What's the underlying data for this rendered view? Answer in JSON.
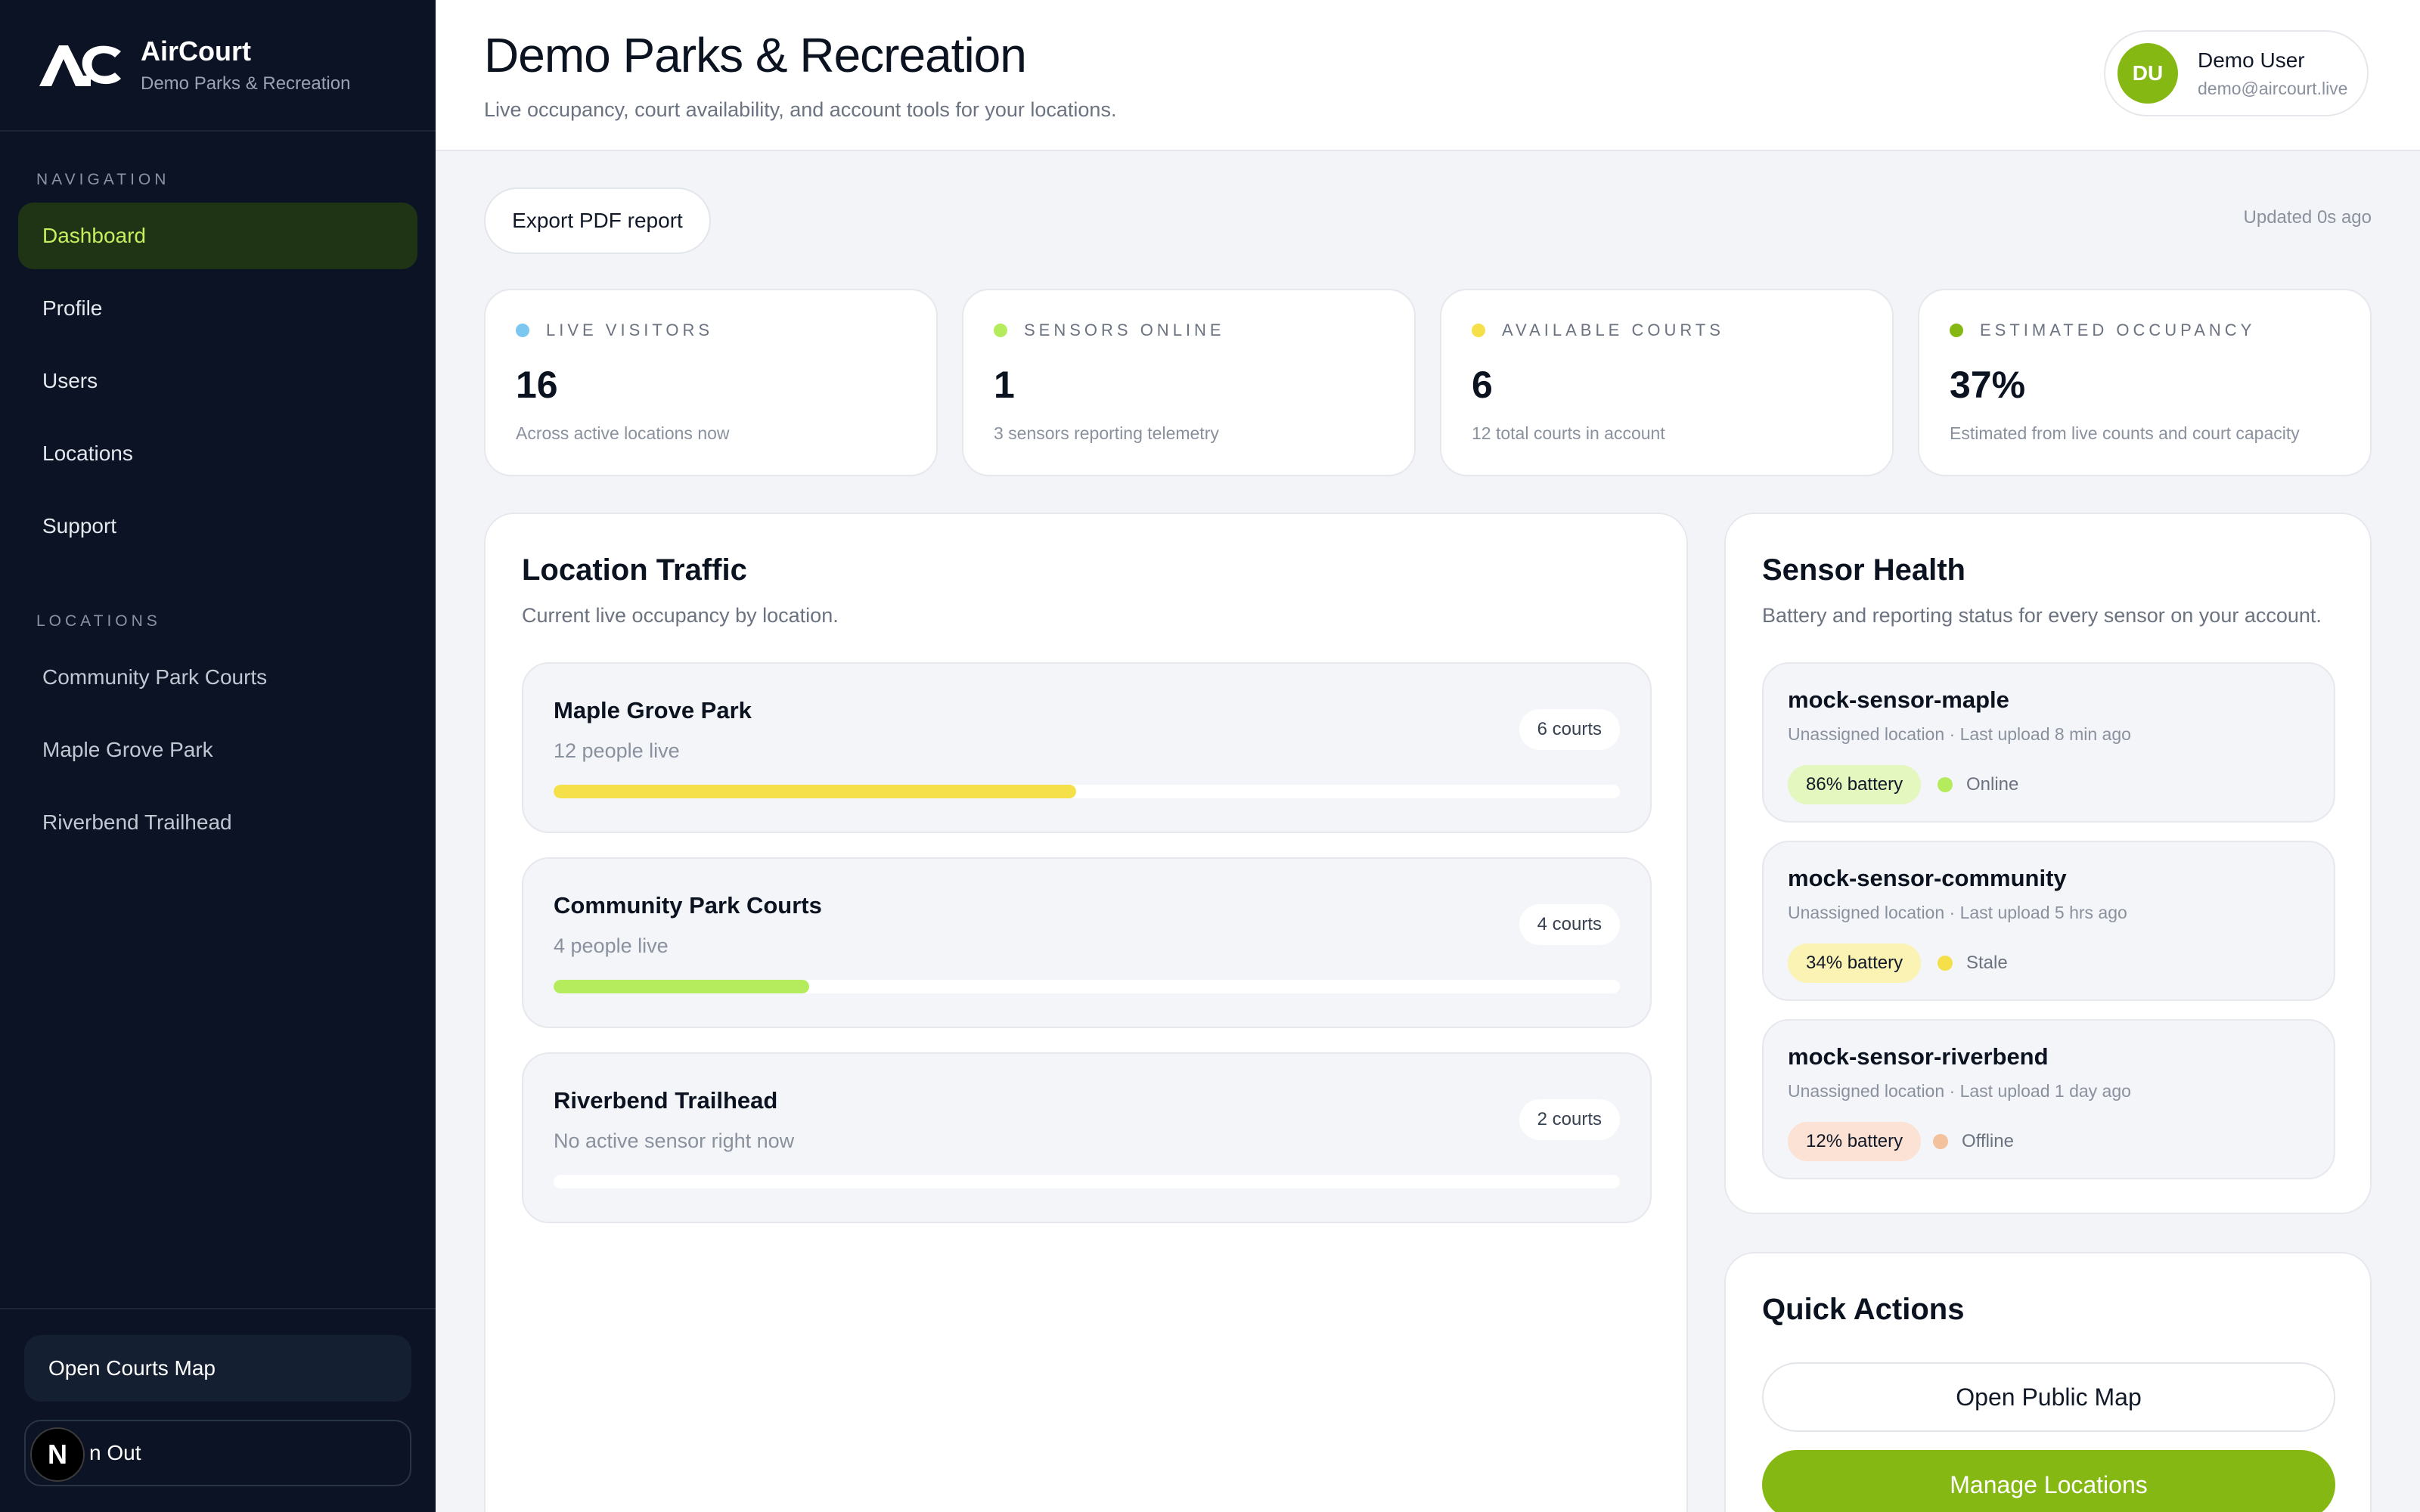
{
  "brand": {
    "name": "AirCourt",
    "subtitle": "Demo Parks & Recreation"
  },
  "sidebar": {
    "nav_heading": "NAVIGATION",
    "nav_items": [
      {
        "label": "Dashboard",
        "active": true
      },
      {
        "label": "Profile"
      },
      {
        "label": "Users"
      },
      {
        "label": "Locations"
      },
      {
        "label": "Support"
      }
    ],
    "locations_heading": "LOCATIONS",
    "locations": [
      {
        "label": "Community Park Courts"
      },
      {
        "label": "Maple Grove Park"
      },
      {
        "label": "Riverbend Trailhead"
      }
    ],
    "open_map_label": "Open Courts Map",
    "sign_out_label": "n Out",
    "overlay_badge": "N"
  },
  "header": {
    "title": "Demo Parks & Recreation",
    "subtitle": "Live occupancy, court availability, and account tools for your locations.",
    "user": {
      "initials": "DU",
      "name": "Demo User",
      "email": "demo@aircourt.live"
    }
  },
  "toolbar": {
    "export_label": "Export PDF report",
    "updated_text": "Updated 0s ago"
  },
  "stats": [
    {
      "label": "LIVE VISITORS",
      "value": "16",
      "note": "Across active locations now",
      "color": "#7cc7f0"
    },
    {
      "label": "SENSORS ONLINE",
      "value": "1",
      "note": "3 sensors reporting telemetry",
      "color": "#b5ec5e"
    },
    {
      "label": "AVAILABLE COURTS",
      "value": "6",
      "note": "12 total courts in account",
      "color": "#f5e04a"
    },
    {
      "label": "ESTIMATED OCCUPANCY",
      "value": "37%",
      "note": "Estimated from live counts and court capacity",
      "color": "#86b814"
    }
  ],
  "traffic": {
    "title": "Location Traffic",
    "subtitle": "Current live occupancy by location.",
    "locations": [
      {
        "name": "Maple Grove Park",
        "people": "12 people live",
        "courts": "6 courts",
        "fill": 0.49,
        "color": "#f5e04a"
      },
      {
        "name": "Community Park Courts",
        "people": "4 people live",
        "courts": "4 courts",
        "fill": 0.24,
        "color": "#b5ec5e"
      },
      {
        "name": "Riverbend Trailhead",
        "people": "No active sensor right now",
        "courts": "2 courts",
        "fill": 0,
        "color": "#b5ec5e"
      }
    ]
  },
  "sensor_health": {
    "title": "Sensor Health",
    "subtitle": "Battery and reporting status for every sensor on your account.",
    "sensors": [
      {
        "name": "mock-sensor-maple",
        "meta": "Unassigned location · Last upload 8 min ago",
        "battery": "86% battery",
        "battery_bg": "#e3f7bf",
        "status": "Online",
        "status_color": "#b5ec5e"
      },
      {
        "name": "mock-sensor-community",
        "meta": "Unassigned location · Last upload 5 hrs ago",
        "battery": "34% battery",
        "battery_bg": "#fbf3b4",
        "status": "Stale",
        "status_color": "#f5e04a"
      },
      {
        "name": "mock-sensor-riverbend",
        "meta": "Unassigned location · Last upload 1 day ago",
        "battery": "12% battery",
        "battery_bg": "#fbe2d4",
        "status": "Offline",
        "status_color": "#f3c19c"
      }
    ]
  },
  "quick_actions": {
    "title": "Quick Actions",
    "open_public_map": "Open Public Map",
    "manage_locations": "Manage Locations"
  },
  "colors": {
    "accent": "#86b814",
    "sidebar_bg": "#0b1324",
    "active_nav_bg": "#1f3415",
    "active_nav_text": "#c6ef5f"
  }
}
